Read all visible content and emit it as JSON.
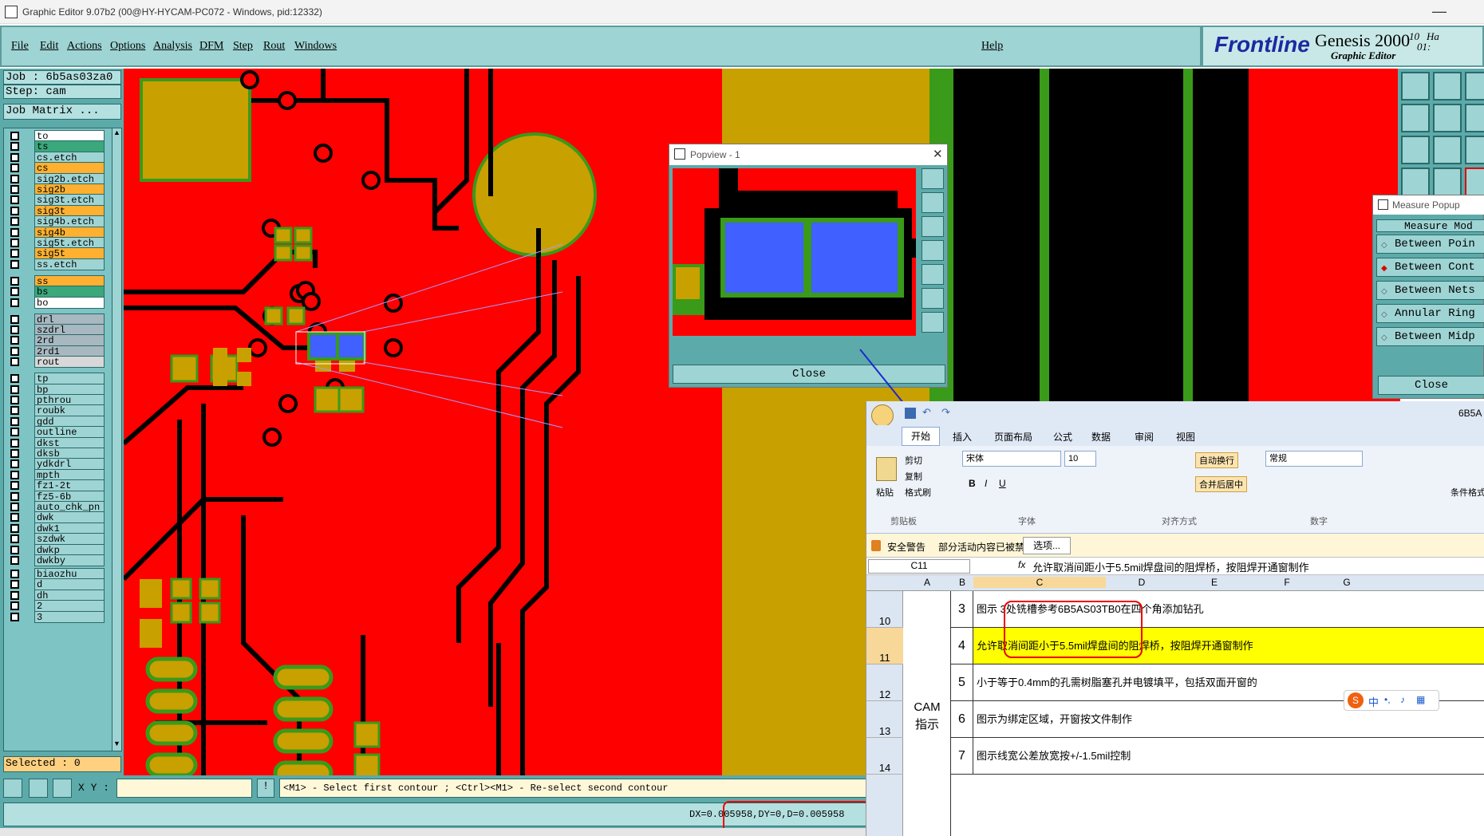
{
  "window": {
    "title": "Graphic Editor 9.07b2 (00@HY-HYCAM-PC072 - Windows, pid:12332)",
    "minimize": "—"
  },
  "menu": {
    "items": [
      "File",
      "Edit",
      "Actions",
      "Options",
      "Analysis",
      "DFM",
      "Step",
      "Rout",
      "Windows"
    ],
    "help": "Help"
  },
  "brand": {
    "logo": "Frontline",
    "product": "Genesis 2000",
    "subtitle": "Graphic Editor",
    "time1": "10",
    "time2": "01:",
    "time_suffix": "Ha"
  },
  "job": {
    "job_line": "Job : 6b5as03za0",
    "step_line": "Step: cam",
    "matrix_button": "Job Matrix ..."
  },
  "layers": [
    "to",
    "ts",
    "cs.etch",
    "cs",
    "sig2b.etch",
    "sig2b",
    "sig3t.etch",
    "sig3t",
    "sig4b.etch",
    "sig4b",
    "sig5t.etch",
    "sig5t",
    "ss.etch",
    "ss",
    "bs",
    "bo",
    "drl",
    "szdrl",
    "2rd",
    "2rd1",
    "rout",
    "tp",
    "bp",
    "pthrou",
    "roubk",
    "gdd",
    "outline",
    "dkst",
    "dksb",
    "ydkdrl",
    "mpth",
    "fz1-2t",
    "fz5-6b",
    "auto_chk_pn",
    "dwk",
    "dwk1",
    "szdwk",
    "dwkp",
    "dwkby",
    "biaozhu",
    "d",
    "dh",
    "2",
    "3"
  ],
  "selected": "Selected : 0",
  "coords": {
    "label": "X Y :",
    "value": ""
  },
  "prompt": "<M1> - Select first contour ; <Ctrl><M1> - Re-select second contour",
  "measure_result": "DX=0.005958,DY=0,D=0.005958",
  "popview": {
    "title": "Popview - 1",
    "close": "Close"
  },
  "measure_popup": {
    "title": "Measure Popup",
    "mode_header": "Measure Mod",
    "options": [
      "Between Poin",
      "Between Cont",
      "Between Nets",
      "Annular Ring",
      "Between Midp"
    ],
    "close": "Close"
  },
  "excel": {
    "filename": "6B5A",
    "tabs": [
      "开始",
      "插入",
      "页面布局",
      "公式",
      "数据",
      "审阅",
      "视图"
    ],
    "clipboard": {
      "paste": "粘贴",
      "cut": "剪切",
      "copy": "复制",
      "format_painter": "格式刷",
      "group": "剪贴板"
    },
    "font": {
      "name": "宋体",
      "size": "10",
      "group": "字体"
    },
    "alignment": {
      "wrap": "自动换行",
      "merge": "合并后居中",
      "group": "对齐方式"
    },
    "number": {
      "format": "常规",
      "group": "数字"
    },
    "styles": {
      "conditional": "条件格式"
    },
    "security": {
      "label": "安全警告",
      "message": "部分活动内容已被禁用。",
      "button": "选项..."
    },
    "name_box": "C11",
    "formula": "允许取消间距小于5.5mil焊盘间的阻焊桥，按阻焊开通窗制作",
    "columns": [
      "A",
      "B",
      "C",
      "D",
      "E",
      "F",
      "G"
    ],
    "cam_label": "CAM\n指示",
    "rows": [
      {
        "row": "10",
        "num": "3",
        "text": "图示 3处铣槽参考6B5AS03TB0在四个角添加钻孔"
      },
      {
        "row": "11",
        "num": "4",
        "text": "允许取消间距小于5.5mil焊盘间的阻焊桥，按阻焊开通窗制作"
      },
      {
        "row": "12",
        "num": "5",
        "text": "小于等于0.4mm的孔需树脂塞孔并电镀填平，包括双面开窗的"
      },
      {
        "row": "13",
        "num": "6",
        "text": "图示为绑定区域，开窗按文件制作"
      },
      {
        "row": "14",
        "num": "7",
        "text": "图示线宽公差放宽按+/-1.5mil控制"
      }
    ],
    "ime": "中"
  },
  "colors": {
    "teal": "#9fd4d4",
    "teal_dark": "#5daaaa",
    "pcb_red": "#ff0000",
    "pcb_green": "#3a9a1a",
    "pad_olive": "#c8a000",
    "pad_blue": "#4060ff",
    "highlight_yellow": "#ffff00"
  }
}
